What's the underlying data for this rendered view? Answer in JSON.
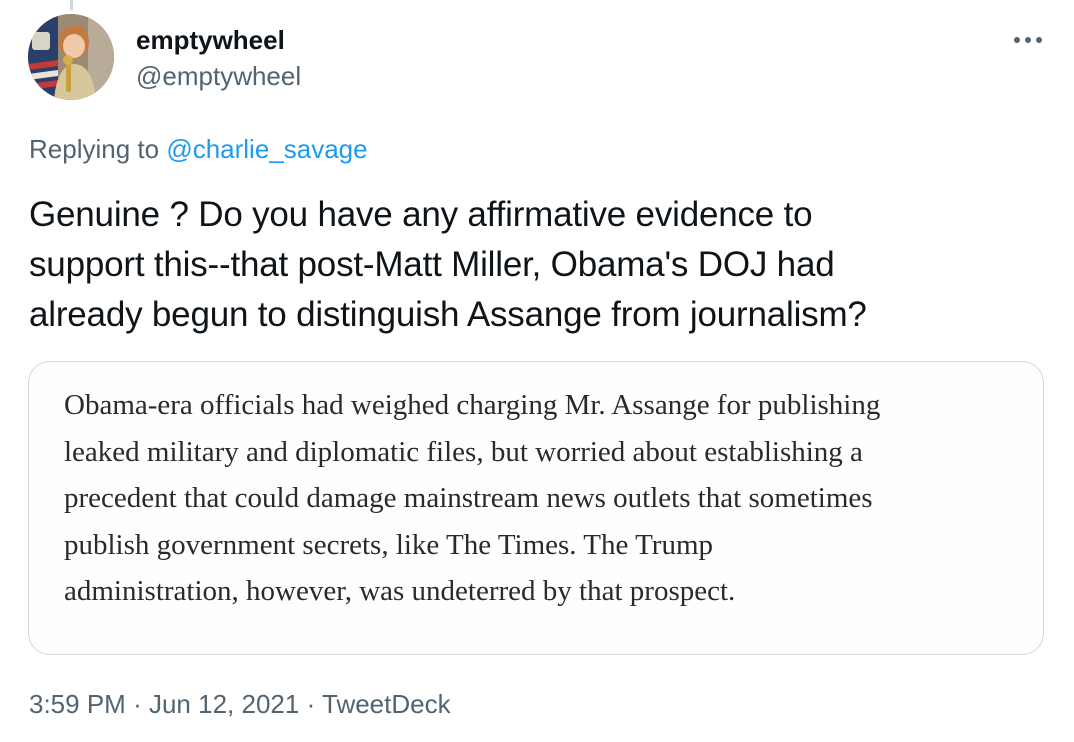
{
  "tweet": {
    "author": {
      "display_name": "emptywheel",
      "handle": "@emptywheel"
    },
    "reply_prefix": "Replying to",
    "reply_to": "@charlie_savage",
    "text_lines": [
      "Genuine ? Do you have any affirmative evidence to",
      "support this--that post-Matt Miller, Obama's DOJ had",
      "already begun to distinguish Assange from journalism?"
    ],
    "media_text_lines": [
      "Obama-era officials had weighed charging Mr. Assange for publishing",
      "leaked military and diplomatic files, but worried about establishing a",
      "precedent that could damage mainstream news outlets that sometimes",
      "publish government secrets, like The Times. The Trump",
      "administration, however, was undeterred by that prospect."
    ],
    "time": "3:59 PM",
    "date": "Jun 12, 2021",
    "source": "TweetDeck",
    "separator": "·"
  },
  "icons": {
    "more": "more-horizontal-icon",
    "avatar": "profile-photo"
  },
  "colors": {
    "text_primary": "#0f1419",
    "text_secondary": "#536471",
    "link": "#1d9bf0",
    "card_border": "#cfd9de"
  }
}
